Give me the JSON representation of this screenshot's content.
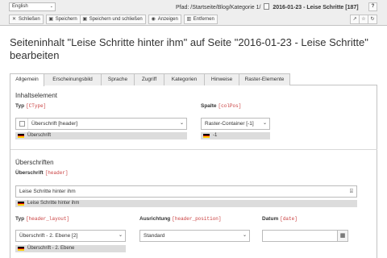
{
  "colors": {
    "topbar_bg": "#eeeeee",
    "field_code": "#c83c3c",
    "flag_black": "#000000",
    "flag_red": "#dd0000",
    "flag_gold": "#ffce00"
  },
  "topbar": {
    "language": "English",
    "path_label": "Pfad: /Startseite/Blog/Kategorie 1/",
    "page_title": "2016-01-23 - Leise Schritte [187]",
    "help_label": "?",
    "buttons": [
      {
        "icon": "close-icon",
        "label": "Schließen"
      },
      {
        "icon": "save-icon",
        "label": "Speichern"
      },
      {
        "icon": "save-icon",
        "label": "Speichern und schließen"
      },
      {
        "icon": "eye-icon",
        "label": "Anzeigen"
      },
      {
        "icon": "trash-icon",
        "label": "Entfernen"
      }
    ],
    "right_icons": [
      "open-new-window-icon",
      "star-icon",
      "refresh-icon"
    ]
  },
  "heading": "Seiteninhalt \"Leise Schritte hinter ihm\" auf Seite \"2016-01-23 - Leise Schritte\" bearbeiten",
  "tabs": [
    {
      "label": "Allgemein",
      "active": true
    },
    {
      "label": "Erscheinungsbild",
      "active": false
    },
    {
      "label": "Sprache",
      "active": false
    },
    {
      "label": "Zugriff",
      "active": false
    },
    {
      "label": "Kategorien",
      "active": false
    },
    {
      "label": "Hinweise",
      "active": false
    },
    {
      "label": "Raster-Elemente",
      "active": false
    }
  ],
  "inhaltselement": {
    "title": "Inhaltselement",
    "typ": {
      "label": "Typ",
      "code": "[CType]",
      "value": "Überschrift [header]",
      "original": "Überschrift"
    },
    "spalte": {
      "label": "Spalte",
      "code": "[colPos]",
      "value": "Raster-Container [-1]",
      "original": "-1"
    }
  },
  "ueberschriften": {
    "title": "Überschriften",
    "header": {
      "label": "Überschrift",
      "code": "[header]",
      "value": "Leise Schritte hinter ihm",
      "original": "Leise Schritte hinter ihm"
    },
    "layout": {
      "label": "Typ",
      "code": "[header_layout]",
      "value": "Überschrift - 2. Ebene [2]",
      "original": "Überschrift - 2. Ebene"
    },
    "position": {
      "label": "Ausrichtung",
      "code": "[header_position]",
      "value": "Standard"
    },
    "date": {
      "label": "Datum",
      "code": "[date]",
      "value": ""
    }
  }
}
